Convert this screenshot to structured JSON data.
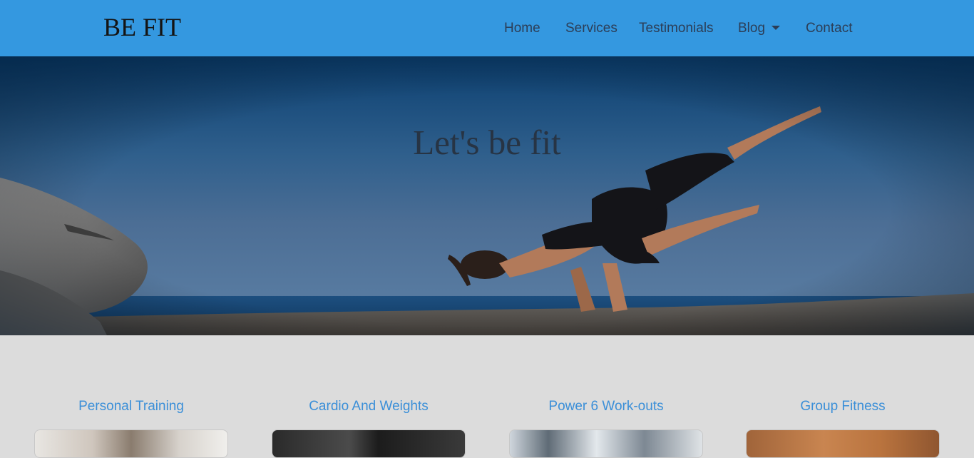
{
  "brand": "BE FIT",
  "nav": {
    "items": [
      {
        "label": "Home"
      },
      {
        "label": "Services"
      },
      {
        "label": "Testimonials"
      },
      {
        "label": "Blog"
      },
      {
        "label": "Contact"
      }
    ]
  },
  "hero": {
    "title": "Let's be fit"
  },
  "services": {
    "cards": [
      {
        "title": "Personal Training"
      },
      {
        "title": "Cardio And Weights"
      },
      {
        "title": "Power 6 Work-outs"
      },
      {
        "title": "Group Fitness"
      }
    ]
  },
  "colors": {
    "navbar": "#3498e0",
    "nav_text": "#2c3e57",
    "card_title": "#3b8fd8",
    "page_bg": "#dcdcdc"
  }
}
